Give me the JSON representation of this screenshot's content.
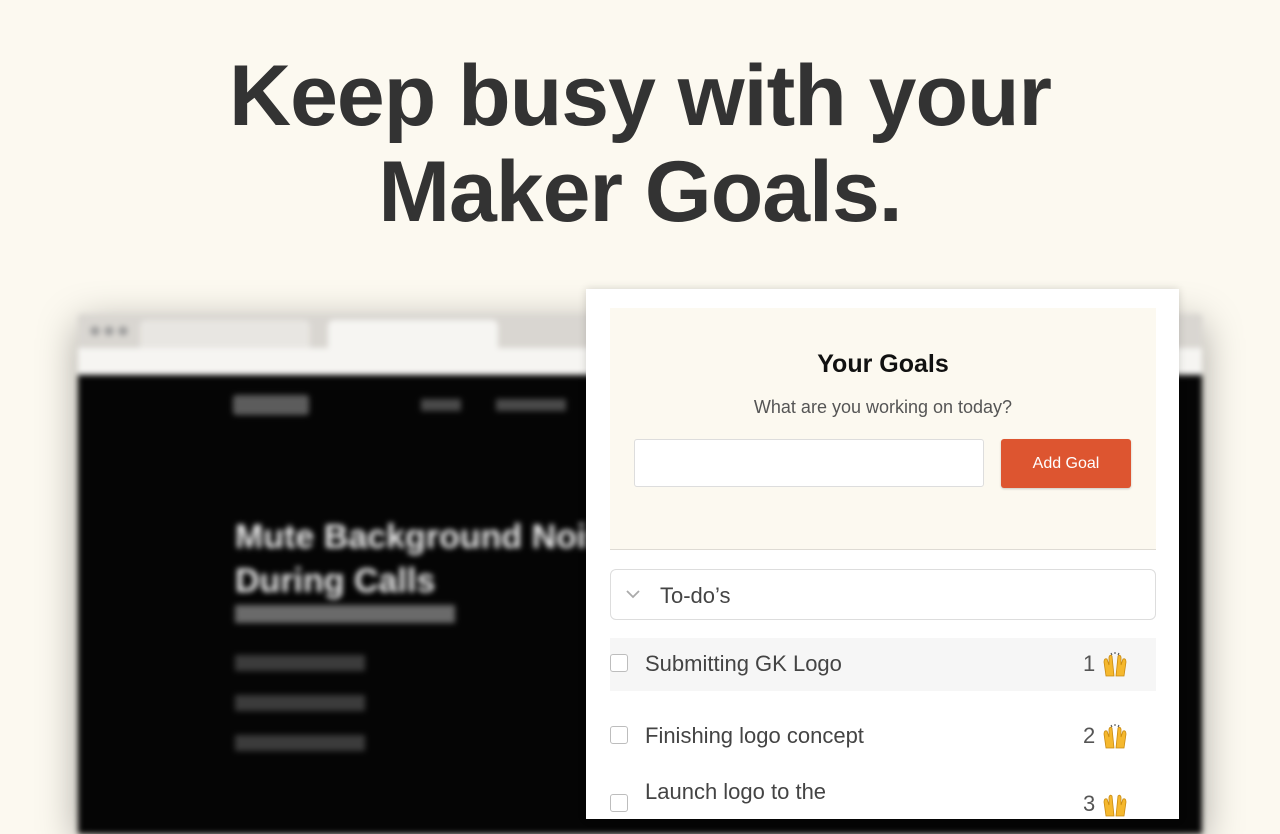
{
  "hero": {
    "line1": "Keep busy with your",
    "line2": "Maker Goals."
  },
  "background_page": {
    "headline": "Mute Background Noise During Calls"
  },
  "popup": {
    "title": "Your Goals",
    "subtitle": "What are you working on today?",
    "input_value": "",
    "input_placeholder": "",
    "add_button_label": "Add Goal",
    "accent_color": "#dd5530",
    "section": {
      "label": "To-do’s",
      "icon": "chevron-down-icon"
    },
    "goals": [
      {
        "text": "Submitting GK Logo",
        "count": "1",
        "icon": "raising-hands-icon",
        "checked": false
      },
      {
        "text": "Finishing logo concept",
        "count": "2",
        "icon": "raising-hands-icon",
        "checked": false
      },
      {
        "text": "Launch logo to the",
        "count": "3",
        "icon": "raising-hands-icon",
        "checked": false
      }
    ]
  }
}
